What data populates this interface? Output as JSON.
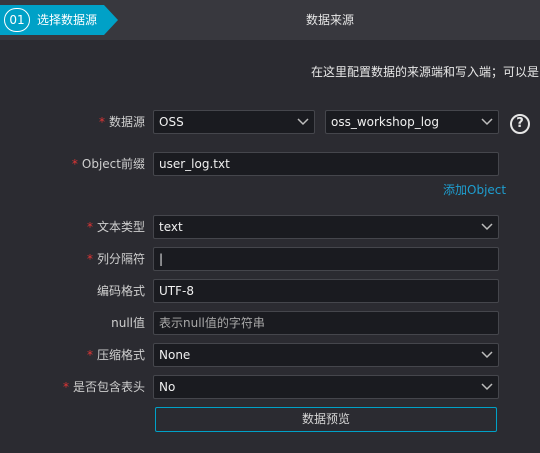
{
  "header": {
    "step_number": "01",
    "step_label": "选择数据源",
    "title": "数据来源"
  },
  "description": "在这里配置数据的来源端和写入端；可以是",
  "form": {
    "datasource": {
      "label": "数据源",
      "required": "*",
      "type_value": "OSS",
      "name_value": "oss_workshop_log"
    },
    "object_prefix": {
      "label": "Object前缀",
      "required": "*",
      "value": "user_log.txt"
    },
    "add_object_link": "添加Object",
    "text_type": {
      "label": "文本类型",
      "required": "*",
      "value": "text"
    },
    "column_delimiter": {
      "label": "列分隔符",
      "required": "*",
      "value": "|"
    },
    "encoding": {
      "label": "编码格式",
      "value": "UTF-8"
    },
    "null_value": {
      "label": "null值",
      "placeholder": "表示null值的字符串"
    },
    "compression": {
      "label": "压缩格式",
      "required": "*",
      "value": "None"
    },
    "include_header": {
      "label": "是否包含表头",
      "required": "*",
      "value": "No"
    },
    "preview_button": "数据预览"
  },
  "icons": {
    "help": "question-circle-icon",
    "dropdown": "chevron-down-icon"
  },
  "colors": {
    "accent": "#00a1c7",
    "required": "#e03535",
    "link": "#1e9ed0",
    "background": "#2b2b31",
    "input_bg": "#1a1b20"
  }
}
